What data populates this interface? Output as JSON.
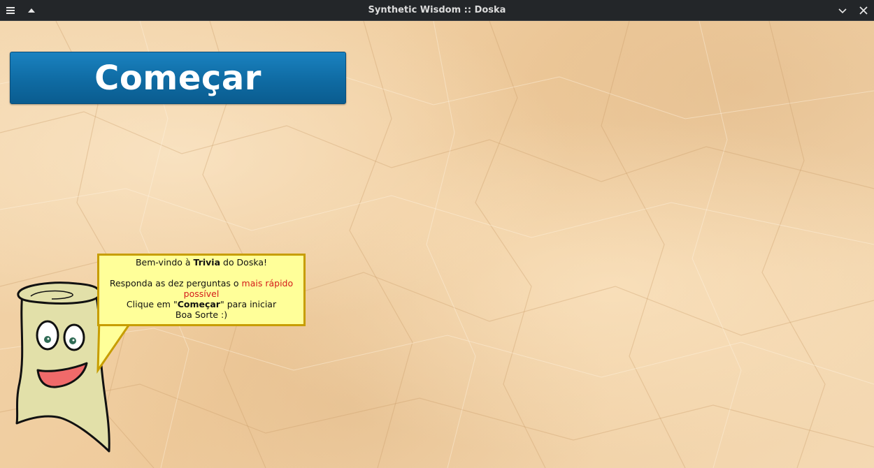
{
  "window": {
    "title": "Synthetic Wisdom :: Doska",
    "icons": [
      "menu-icon",
      "keep-above-icon",
      "minimize-icon",
      "close-icon"
    ]
  },
  "main": {
    "start_button_label": "Começar",
    "start_button_color": "#0f6ba3",
    "background_color": "#efcfa4"
  },
  "bubble": {
    "line1_pre": "Bem-vindo à ",
    "line1_bold": "Trivia",
    "line1_post": " do Doska!",
    "line2_pre": "Responda as dez perguntas o ",
    "line2_red": "mais rápido",
    "line3_red": "possível",
    "line4_pre": "Clique em \"",
    "line4_bold": "Começar",
    "line4_post": "\" para iniciar",
    "line5": "Boa Sorte :)",
    "fill_color": "#ffff99",
    "border_color": "#c79d00",
    "highlight_color": "#d41a1a"
  }
}
